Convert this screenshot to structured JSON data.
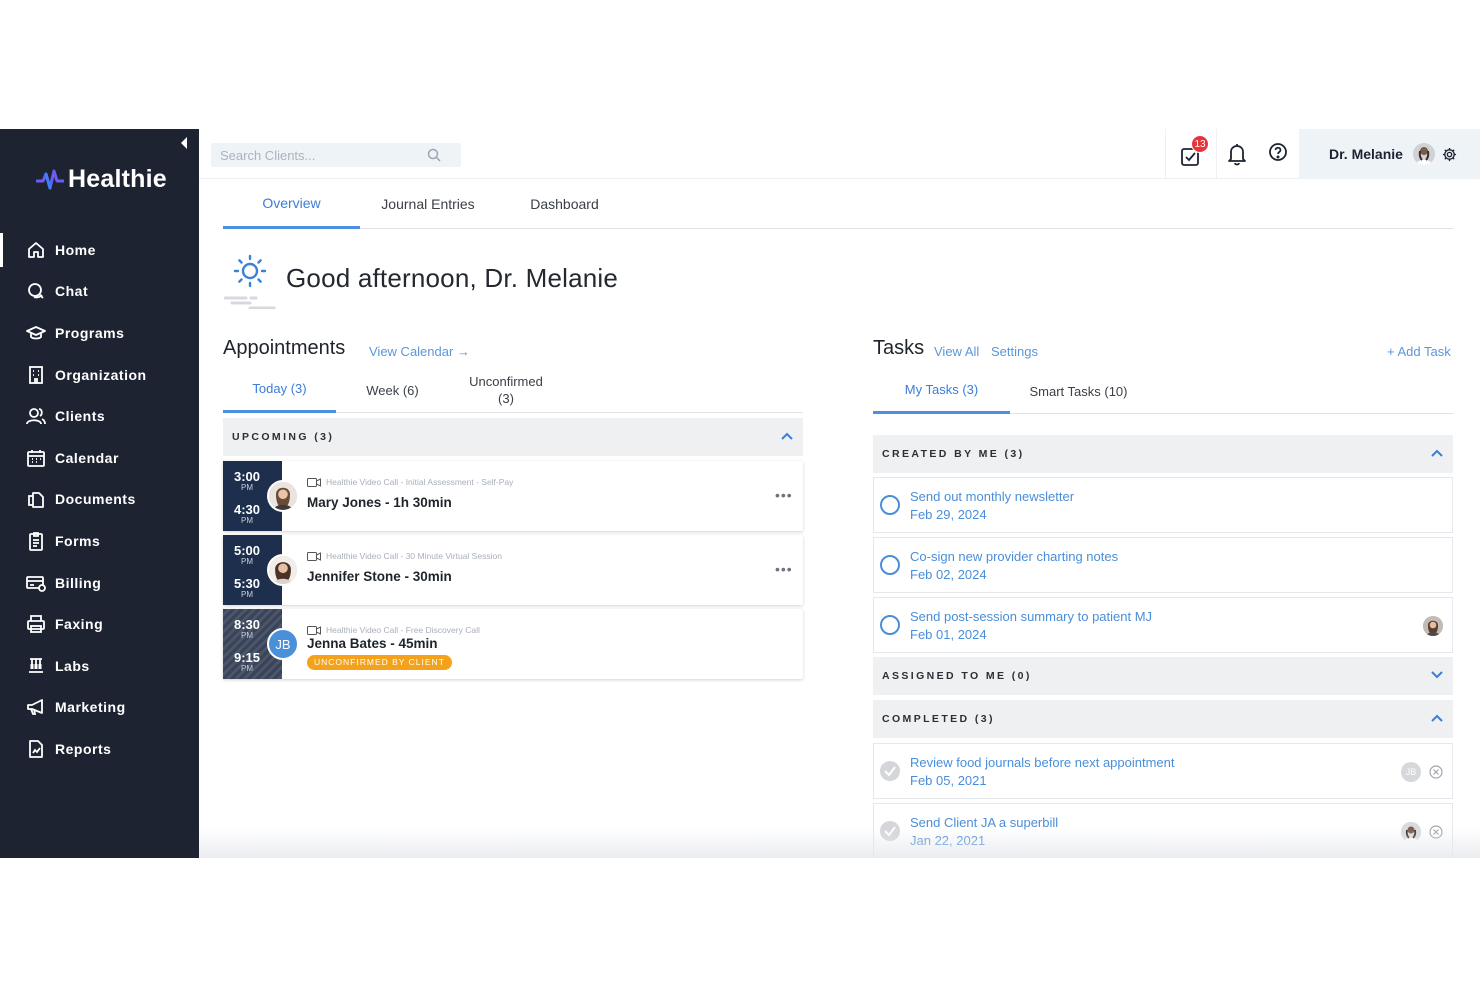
{
  "brand": {
    "name": "Healthie"
  },
  "sidebar": {
    "items": [
      {
        "label": "Home",
        "icon": "home-icon",
        "active": true
      },
      {
        "label": "Chat",
        "icon": "chat-icon"
      },
      {
        "label": "Programs",
        "icon": "graduation-cap-icon"
      },
      {
        "label": "Organization",
        "icon": "building-icon"
      },
      {
        "label": "Clients",
        "icon": "users-icon"
      },
      {
        "label": "Calendar",
        "icon": "calendar-icon"
      },
      {
        "label": "Documents",
        "icon": "documents-icon"
      },
      {
        "label": "Forms",
        "icon": "clipboard-icon"
      },
      {
        "label": "Billing",
        "icon": "credit-card-icon"
      },
      {
        "label": "Faxing",
        "icon": "printer-icon"
      },
      {
        "label": "Labs",
        "icon": "test-tubes-icon"
      },
      {
        "label": "Marketing",
        "icon": "megaphone-icon"
      },
      {
        "label": "Reports",
        "icon": "report-icon"
      }
    ]
  },
  "header": {
    "search_placeholder": "Search Clients...",
    "tasks_badge": "13",
    "user_name": "Dr. Melanie"
  },
  "main_tabs": [
    "Overview",
    "Journal Entries",
    "Dashboard"
  ],
  "greeting": "Good afternoon, Dr. Melanie",
  "appointments": {
    "title": "Appointments",
    "view_calendar": "View Calendar →",
    "tabs": [
      "Today (3)",
      "Week (6)",
      "Unconfirmed",
      "(3)"
    ],
    "group_label": "UPCOMING (3)",
    "items": [
      {
        "start": "3:00",
        "start_ampm": "PM",
        "end": "4:30",
        "end_ampm": "PM",
        "type": "Healthie Video Call - Initial Assessment - Self-Pay",
        "name": "Mary Jones - 1h 30min",
        "more": "•••"
      },
      {
        "start": "5:00",
        "start_ampm": "PM",
        "end": "5:30",
        "end_ampm": "PM",
        "type": "Healthie Video Call - 30 Minute Virtual Session",
        "name": "Jennifer Stone - 30min",
        "more": "•••"
      },
      {
        "start": "8:30",
        "start_ampm": "PM",
        "end": "9:15",
        "end_ampm": "PM",
        "type": "Healthie Video Call - Free Discovery Call",
        "name": "Jenna Bates - 45min",
        "initials": "JB",
        "status": "UNCONFIRMED BY CLIENT"
      }
    ]
  },
  "tasks": {
    "title": "Tasks",
    "view_all": "View All",
    "settings": "Settings",
    "add_task": "+ Add Task",
    "tabs": [
      "My Tasks (3)",
      "Smart Tasks (10)"
    ],
    "groups": {
      "created": "CREATED BY ME (3)",
      "assigned": "ASSIGNED TO ME (0)",
      "completed": "COMPLETED (3)"
    },
    "created_items": [
      {
        "title": "Send out monthly newsletter",
        "date": "Feb 29, 2024"
      },
      {
        "title": "Co-sign new provider charting notes",
        "date": "Feb 02, 2024"
      },
      {
        "title": "Send post-session summary to patient MJ",
        "date": "Feb 01, 2024"
      }
    ],
    "completed_items": [
      {
        "title": "Review food journals before next appointment",
        "date": "Feb 05, 2021",
        "initials": "JB"
      },
      {
        "title": "Send Client JA a superbill",
        "date": "Jan 22, 2021"
      }
    ]
  },
  "colors": {
    "sidebar": "#1e2331",
    "accent": "#4a8ed9",
    "badge": "#e8353b",
    "warning": "#f4a21c"
  }
}
